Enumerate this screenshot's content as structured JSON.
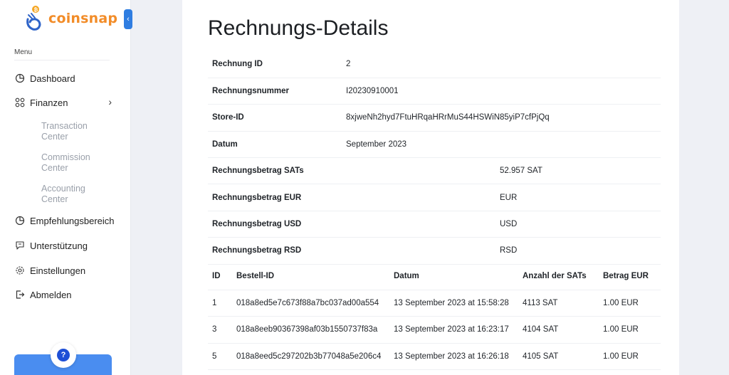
{
  "sidebar": {
    "brand": "coinsnap",
    "menu_title": "Menu",
    "items": [
      {
        "label": "Dashboard",
        "icon": "pie-chart-icon"
      },
      {
        "label": "Finanzen",
        "icon": "grid-icon"
      },
      {
        "label": "Empfehlungsbereich",
        "icon": "pie-chart-icon"
      },
      {
        "label": "Unterstützung",
        "icon": "support-icon"
      },
      {
        "label": "Einstellungen",
        "icon": "gear-icon"
      },
      {
        "label": "Abmelden",
        "icon": "logout-icon"
      }
    ],
    "finanzen_sub": [
      {
        "label": "Transaction Center"
      },
      {
        "label": "Commission Center"
      },
      {
        "label": "Accounting Center"
      }
    ],
    "help_symbol": "?"
  },
  "colors": {
    "accent": "#2f7de1",
    "brand_orange": "#f28c28",
    "help_card": "#4a8df0",
    "help_dot": "#1e4fd6",
    "sub_text": "#9aa0aa"
  },
  "page": {
    "title": "Rechnungs-Details"
  },
  "details": [
    {
      "key": "Rechnung ID",
      "value": "2"
    },
    {
      "key": "Rechnungsnummer",
      "value": "I20230910001"
    },
    {
      "key": "Store-ID",
      "value": "8xjweNh2hyd7FtuHRqaHRrMuS44HSWiN85yiP7cfPjQq"
    },
    {
      "key": "Datum",
      "value": "September 2023"
    },
    {
      "key": "Rechnungsbetrag SATs",
      "value": "52.957 SAT"
    },
    {
      "key": "Rechnungsbetrag EUR",
      "value": "EUR"
    },
    {
      "key": "Rechnungsbetrag USD",
      "value": "USD"
    },
    {
      "key": "Rechnungsbetrag RSD",
      "value": "RSD"
    }
  ],
  "orders": {
    "headers": [
      "ID",
      "Bestell-ID",
      "Datum",
      "Anzahl der SATs",
      "Betrag EUR"
    ],
    "rows": [
      [
        "1",
        "018a8ed5e7c673f88a7bc037ad00a554",
        "13 September 2023 at 15:58:28",
        "4113 SAT",
        "1.00 EUR"
      ],
      [
        "3",
        "018a8eeb90367398af03b1550737f83a",
        "13 September 2023 at 16:23:17",
        "4104 SAT",
        "1.00 EUR"
      ],
      [
        "5",
        "018a8eed5c297202b3b77048a5e206c4",
        "13 September 2023 at 16:26:18",
        "4105 SAT",
        "1.00 EUR"
      ]
    ]
  }
}
